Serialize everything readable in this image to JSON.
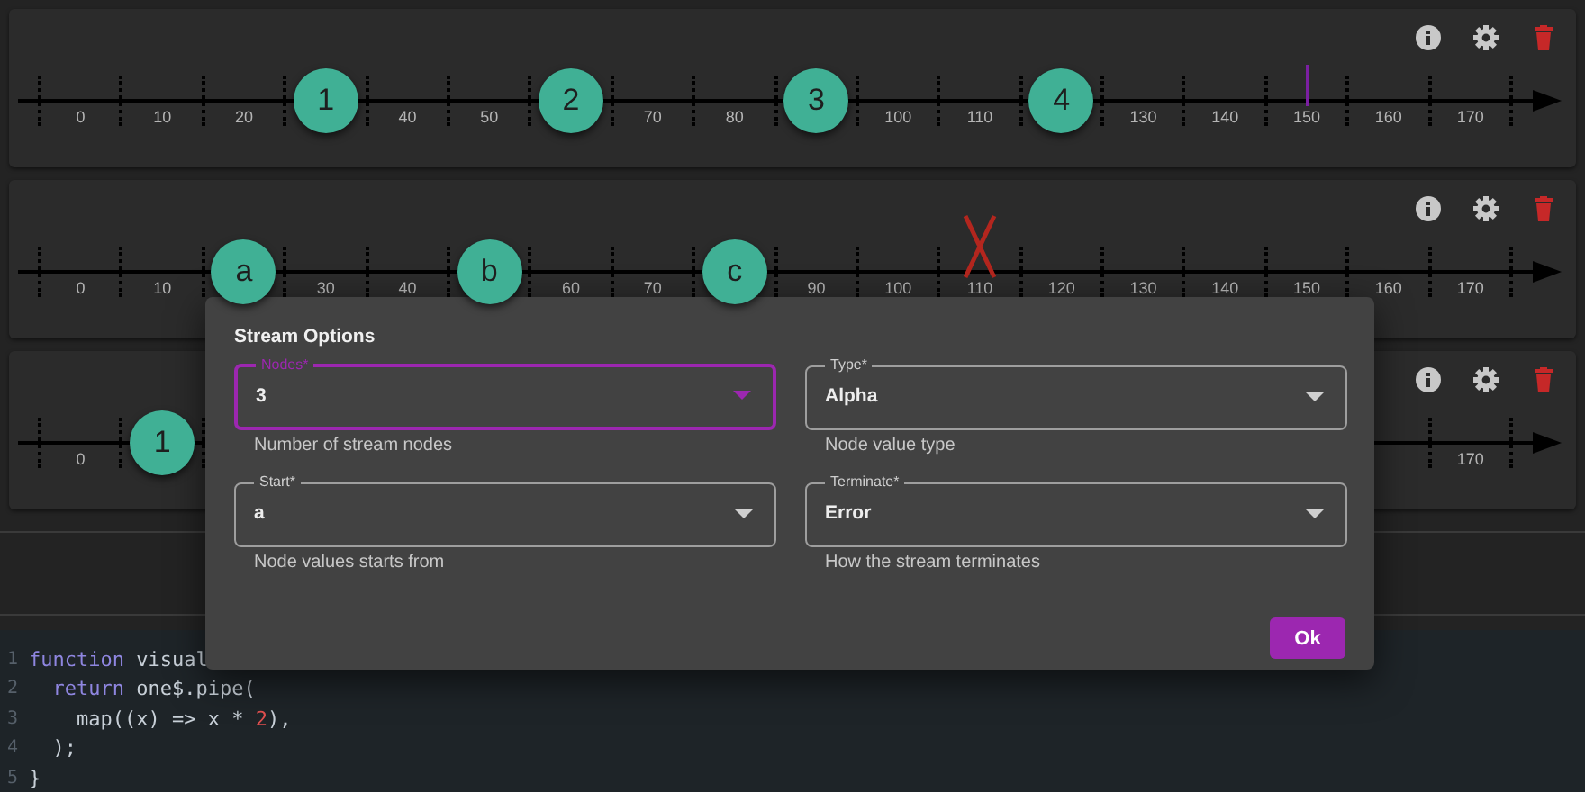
{
  "streams": [
    {
      "slots": [
        {
          "kind": "tick",
          "text": "0"
        },
        {
          "kind": "tick",
          "text": "10"
        },
        {
          "kind": "tick",
          "text": "20"
        },
        {
          "kind": "node",
          "text": "1"
        },
        {
          "kind": "tick",
          "text": "40"
        },
        {
          "kind": "tick",
          "text": "50"
        },
        {
          "kind": "node",
          "text": "2"
        },
        {
          "kind": "tick",
          "text": "70"
        },
        {
          "kind": "tick",
          "text": "80"
        },
        {
          "kind": "node",
          "text": "3"
        },
        {
          "kind": "tick",
          "text": "100"
        },
        {
          "kind": "tick",
          "text": "110"
        },
        {
          "kind": "node",
          "text": "4"
        },
        {
          "kind": "tick",
          "text": "130"
        },
        {
          "kind": "tick",
          "text": "140"
        },
        {
          "kind": "complete",
          "text": "150"
        },
        {
          "kind": "tick",
          "text": "160"
        },
        {
          "kind": "tick",
          "text": "170"
        }
      ]
    },
    {
      "slots": [
        {
          "kind": "tick",
          "text": "0"
        },
        {
          "kind": "tick",
          "text": "10"
        },
        {
          "kind": "node",
          "text": "a"
        },
        {
          "kind": "tick",
          "text": "30"
        },
        {
          "kind": "tick",
          "text": "40"
        },
        {
          "kind": "node",
          "text": "b"
        },
        {
          "kind": "tick",
          "text": "60"
        },
        {
          "kind": "tick",
          "text": "70"
        },
        {
          "kind": "node",
          "text": "c"
        },
        {
          "kind": "tick",
          "text": "90"
        },
        {
          "kind": "tick",
          "text": "100"
        },
        {
          "kind": "error",
          "text": "110"
        },
        {
          "kind": "tick",
          "text": "120"
        },
        {
          "kind": "tick",
          "text": "130"
        },
        {
          "kind": "tick",
          "text": "140"
        },
        {
          "kind": "tick",
          "text": "150"
        },
        {
          "kind": "tick",
          "text": "160"
        },
        {
          "kind": "tick",
          "text": "170"
        }
      ]
    },
    {
      "slots": [
        {
          "kind": "tick",
          "text": "0"
        },
        {
          "kind": "node",
          "text": "1"
        },
        {
          "kind": "blank"
        },
        {
          "kind": "blank"
        },
        {
          "kind": "blank"
        },
        {
          "kind": "blank"
        },
        {
          "kind": "blank"
        },
        {
          "kind": "blank"
        },
        {
          "kind": "blank"
        },
        {
          "kind": "blank"
        },
        {
          "kind": "blank"
        },
        {
          "kind": "blank"
        },
        {
          "kind": "blank"
        },
        {
          "kind": "blank"
        },
        {
          "kind": "blank"
        },
        {
          "kind": "blank"
        },
        {
          "kind": "blank"
        },
        {
          "kind": "tick",
          "text": "170"
        }
      ]
    }
  ],
  "code": {
    "lines": [
      {
        "number": "1",
        "tokens": [
          {
            "kind": "keyword",
            "text": "function"
          },
          {
            "kind": "plain",
            "text": " visual"
          }
        ]
      },
      {
        "number": "2",
        "tokens": [
          {
            "kind": "keyword",
            "text": "  return"
          },
          {
            "kind": "plain",
            "text": " one$.pipe("
          }
        ]
      },
      {
        "number": "3",
        "tokens": [
          {
            "kind": "plain",
            "text": "    map((x) => x * "
          },
          {
            "kind": "number",
            "text": "2"
          },
          {
            "kind": "plain",
            "text": "),"
          }
        ]
      },
      {
        "number": "4",
        "tokens": [
          {
            "kind": "plain",
            "text": "  );"
          }
        ]
      },
      {
        "number": "5",
        "tokens": [
          {
            "kind": "plain",
            "text": "}"
          }
        ]
      }
    ]
  },
  "dialog": {
    "title": "Stream Options",
    "fields": [
      {
        "label": "Nodes*",
        "value": "3",
        "helper": "Number of stream nodes",
        "focused": true
      },
      {
        "label": "Type*",
        "value": "Alpha",
        "helper": "Node value type",
        "focused": false
      },
      {
        "label": "Start*",
        "value": "a",
        "helper": "Node values starts from",
        "focused": false
      },
      {
        "label": "Terminate*",
        "value": "Error",
        "helper": "How the stream terminates",
        "focused": false
      }
    ],
    "buttons": [
      "Ok"
    ]
  }
}
